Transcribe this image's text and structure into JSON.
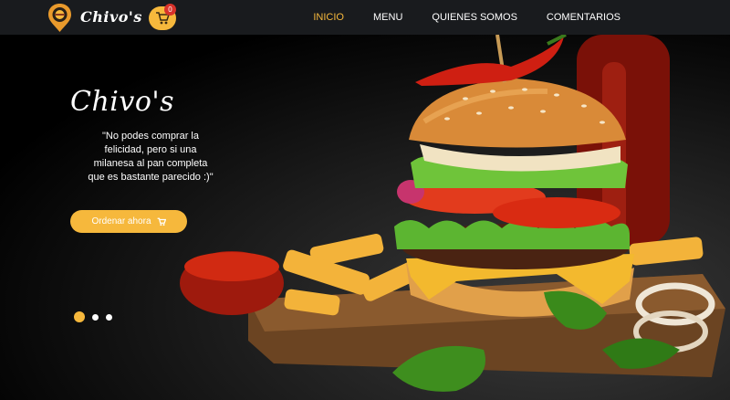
{
  "brand": {
    "name": "Chivo's"
  },
  "cart": {
    "count": "0"
  },
  "nav": [
    {
      "label": "INICIO",
      "active": true
    },
    {
      "label": "MENU",
      "active": false
    },
    {
      "label": "QUIENES SOMOS",
      "active": false
    },
    {
      "label": "COMENTARIOS",
      "active": false
    }
  ],
  "hero": {
    "title": "Chivo's",
    "quote": "\"No podes comprar la felicidad, pero si una milanesa al pan completa que es bastante parecido :)\"",
    "cta": "Ordenar ahora",
    "slides": 3,
    "active_slide": 1
  },
  "colors": {
    "accent": "#f6b83c",
    "navbar": "#191b1e",
    "badge": "#d8322a"
  },
  "icons": [
    "logo-icon",
    "cart-icon"
  ]
}
